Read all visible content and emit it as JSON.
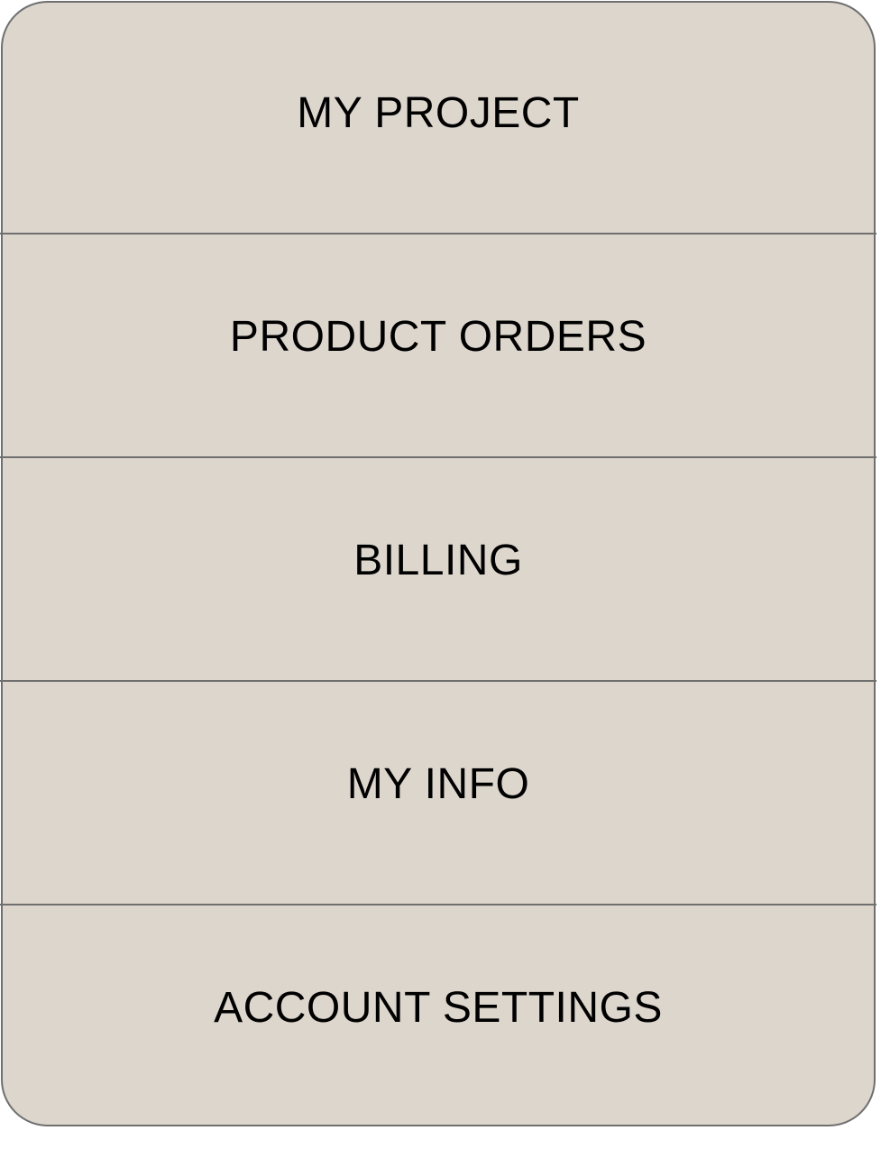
{
  "menu": {
    "items": [
      {
        "label": "MY PROJECT"
      },
      {
        "label": "PRODUCT ORDERS"
      },
      {
        "label": "BILLING"
      },
      {
        "label": "MY INFO"
      },
      {
        "label": "ACCOUNT SETTINGS"
      }
    ]
  },
  "colors": {
    "panel_background": "#ddd6cd",
    "border": "#6f6f6f",
    "text": "#000000"
  }
}
